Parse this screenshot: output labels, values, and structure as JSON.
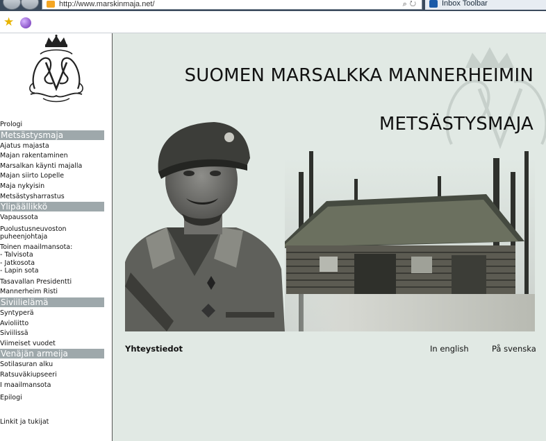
{
  "browser": {
    "url": "http://www.marskinmaja.net/",
    "toolbar_label": "Inbox Toolbar"
  },
  "sidebar": {
    "prologue": "Prologi",
    "sections": [
      {
        "title": "Metsästysmaja",
        "items": [
          "Ajatus majasta",
          "Majan rakentaminen",
          "Marsalkan käynti majalla",
          "Majan siirto Lopelle",
          "Maja nykyisin",
          "Metsästysharrastus"
        ]
      },
      {
        "title": "Ylipäällikkö",
        "items": [
          "Vapaussota",
          "Puolustusneuvoston\npuheenjohtaja",
          "Toinen maailmansota:\n- Talvisota\n- Jatkosota\n- Lapin sota",
          "Tasavallan Presidentti",
          "Mannerheim Risti"
        ]
      },
      {
        "title": "Siviilielämä",
        "items": [
          "Syntyperä",
          "Avioliitto",
          "Siviilissä",
          "Viimeiset vuodet"
        ]
      },
      {
        "title": "Venäjän armeija",
        "items": [
          "Sotilasuran alku",
          "Ratsuväkiupseeri",
          "I maailmansota"
        ]
      }
    ],
    "epilogue": "Epilogi",
    "links": "Linkit ja tukijat"
  },
  "header": {
    "title_line1": "SUOMEN MARSALKKA MANNERHEIMIN",
    "title_line2": "METSÄSTYSMAJA"
  },
  "footer": {
    "contacts": "Yhteystiedot",
    "english": "In english",
    "swedish": "På svenska"
  },
  "icons": {
    "favorites": "star-icon",
    "addon": "orb-icon"
  },
  "colors": {
    "page_bg": "#e1e9e4",
    "section_header": "#9ea8ab"
  }
}
